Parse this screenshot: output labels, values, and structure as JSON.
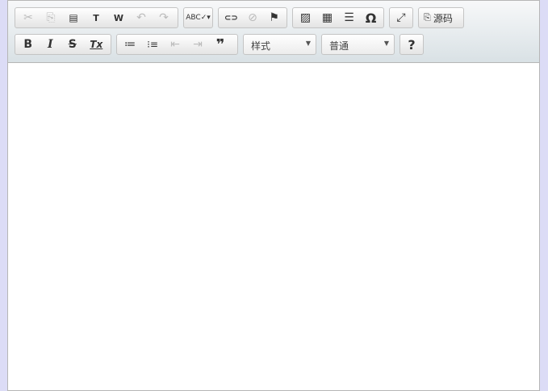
{
  "toolbar": {
    "row1": {
      "clipboard": [
        {
          "icon": "cut-icon",
          "glyph": "✂",
          "disabled": true
        },
        {
          "icon": "copy-icon",
          "glyph": "⎘",
          "disabled": true
        },
        {
          "icon": "paste-icon",
          "glyph": "📋",
          "disabled": false
        },
        {
          "icon": "paste-text-icon",
          "glyph": "T",
          "disabled": false
        },
        {
          "icon": "paste-word-icon",
          "glyph": "W",
          "disabled": false
        }
      ],
      "undo": [
        {
          "icon": "undo-icon",
          "glyph": "↶",
          "disabled": true
        },
        {
          "icon": "redo-icon",
          "glyph": "↷",
          "disabled": true
        }
      ],
      "spellcheck_glyph": "ABC✓▾",
      "links": [
        {
          "icon": "link-icon",
          "glyph": "⊂⊃"
        },
        {
          "icon": "unlink-icon",
          "glyph": "⊘"
        },
        {
          "icon": "anchor-flag-icon",
          "glyph": "⚑"
        }
      ],
      "insert": [
        {
          "icon": "image-icon",
          "glyph": "▨"
        },
        {
          "icon": "table-icon",
          "glyph": "▦"
        },
        {
          "icon": "horizontal-rule-icon",
          "glyph": "☰"
        },
        {
          "icon": "special-char-icon",
          "glyph": "Ω"
        }
      ],
      "maximize_glyph": "⤢",
      "source_label": "源码"
    },
    "row2": {
      "format": [
        {
          "icon": "bold-icon",
          "glyph": "B"
        },
        {
          "icon": "italic-icon",
          "glyph": "I"
        },
        {
          "icon": "strike-icon",
          "glyph": "S"
        },
        {
          "icon": "remove-format-icon",
          "glyph": "Tx"
        }
      ],
      "lists": [
        {
          "icon": "numbered-list-icon",
          "glyph": "≔"
        },
        {
          "icon": "bulleted-list-icon",
          "glyph": "⁝≡"
        },
        {
          "icon": "outdent-icon",
          "glyph": "⇤"
        },
        {
          "icon": "indent-icon",
          "glyph": "⇥"
        },
        {
          "icon": "blockquote-icon",
          "glyph": "❞"
        }
      ],
      "style_combo": "样式",
      "format_combo": "普通",
      "help_glyph": "?"
    }
  }
}
